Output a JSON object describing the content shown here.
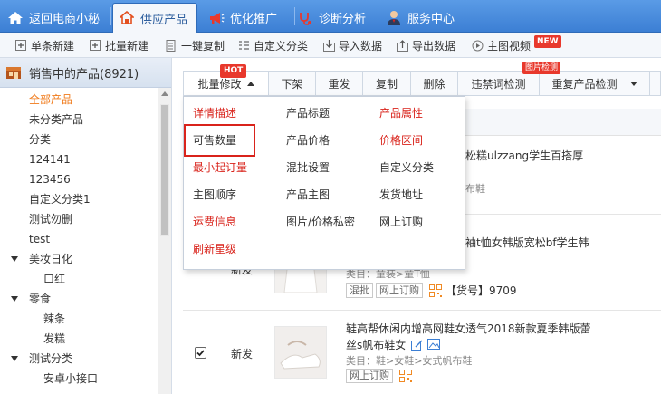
{
  "topbar": {
    "tabs": [
      {
        "label": "返回电商小秘",
        "icon": "home-icon"
      },
      {
        "label": "供应产品",
        "icon": "supply-icon",
        "active": true
      },
      {
        "label": "优化推广",
        "icon": "megaphone-icon"
      },
      {
        "label": "诊断分析",
        "icon": "stethoscope-icon"
      },
      {
        "label": "服务中心",
        "icon": "person-icon"
      }
    ]
  },
  "toolbar": {
    "items": [
      {
        "label": "单条新建",
        "icon": "plus-icon"
      },
      {
        "label": "批量新建",
        "icon": "batch-icon"
      },
      {
        "label": "一键复制",
        "icon": "copy-icon"
      },
      {
        "label": "自定义分类",
        "icon": "category-icon"
      },
      {
        "label": "导入数据",
        "icon": "import-icon"
      },
      {
        "label": "导出数据",
        "icon": "export-icon"
      },
      {
        "label": "主图视频",
        "icon": "video-icon"
      }
    ],
    "new_badge": "NEW"
  },
  "sidebar": {
    "header": "销售中的产品(8921)",
    "tree": [
      {
        "label": "全部产品",
        "level": 0,
        "selected": true
      },
      {
        "label": "未分类产品",
        "level": 0
      },
      {
        "label": "分类一",
        "level": 0
      },
      {
        "label": "124141",
        "level": 0
      },
      {
        "label": "123456",
        "level": 0
      },
      {
        "label": "自定义分类1",
        "level": 0
      },
      {
        "label": "测试勿删",
        "level": 0
      },
      {
        "label": "test",
        "level": 0
      },
      {
        "label": "美妆日化",
        "level": 0,
        "expanded": true
      },
      {
        "label": "口红",
        "level": 1
      },
      {
        "label": "零食",
        "level": 0,
        "expanded": true
      },
      {
        "label": "辣条",
        "level": 1
      },
      {
        "label": "发糕",
        "level": 1
      },
      {
        "label": "测试分类",
        "level": 0,
        "expanded": true
      },
      {
        "label": "安卓小接口",
        "level": 1
      }
    ]
  },
  "actionbar": {
    "buttons": [
      {
        "label": "批量修改"
      },
      {
        "label": "下架"
      },
      {
        "label": "重发"
      },
      {
        "label": "复制"
      },
      {
        "label": "删除"
      },
      {
        "label": "违禁词检测"
      },
      {
        "label": "重复产品检测"
      }
    ],
    "hot_badge": "HOT",
    "check_badge": "图片检测"
  },
  "dropdown": {
    "columns": [
      [
        {
          "label": "详情描述",
          "color": "red"
        },
        {
          "label": "可售数量",
          "color": "dark",
          "highlighted": true
        },
        {
          "label": "最小起订量",
          "color": "red"
        },
        {
          "label": "主图顺序",
          "color": "dark"
        },
        {
          "label": "运费信息",
          "color": "red"
        },
        {
          "label": "刷新星级",
          "color": "red"
        }
      ],
      [
        {
          "label": "产品标题",
          "color": "dark"
        },
        {
          "label": "产品价格",
          "color": "dark"
        },
        {
          "label": "混批设置",
          "color": "dark"
        },
        {
          "label": "产品主图",
          "color": "dark"
        },
        {
          "label": "图片/价格私密",
          "color": "dark"
        }
      ],
      [
        {
          "label": "产品属性",
          "color": "red"
        },
        {
          "label": "价格区间",
          "color": "red"
        },
        {
          "label": "自定义分类",
          "color": "dark"
        },
        {
          "label": "发货地址",
          "color": "dark"
        },
        {
          "label": "网上订购",
          "color": "dark"
        }
      ]
    ]
  },
  "products": [
    {
      "title_fragment": "松糕ulzzang学生百搭厚",
      "category_fragment": "布鞋"
    },
    {
      "title_fragment": "袖t恤女韩版宽松bf学生韩",
      "category": "类目：童装>童T恤",
      "status": "新发",
      "tags": [
        "混批",
        "网上订购"
      ],
      "sku_label": "【货号】9709"
    },
    {
      "title": "鞋高帮休闲内增高网鞋女透气2018新款夏季韩版蕾",
      "title_line2": "丝s帆布鞋女",
      "category": "类目：鞋>女鞋>女式帆布鞋",
      "status": "新发",
      "tags": [
        "网上订购"
      ]
    }
  ],
  "colors": {
    "accent_red": "#d9231b",
    "brand_blue": "#3c7fd4",
    "selected_orange": "#f07a1a"
  }
}
